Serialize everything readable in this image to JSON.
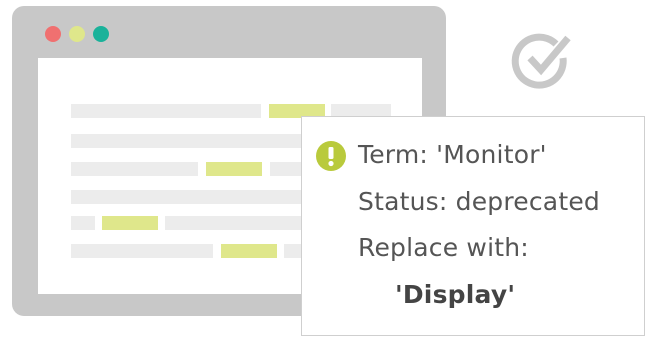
{
  "colors": {
    "frame": "#c8c8c8",
    "dot_red": "#f07070",
    "dot_yellow": "#dfe78b",
    "dot_green": "#1ab29a",
    "highlight": "#dfe78b",
    "placeholder": "#ececec",
    "warning": "#b9ca3c",
    "check": "#c8c8c8"
  },
  "icons": {
    "warning": "exclamation-circle-icon",
    "check": "check-circle-icon"
  },
  "panel": {
    "term": "Term: 'Monitor'",
    "status": "Status: deprecated",
    "replace_label": "Replace with:",
    "replacement": "'Display'"
  }
}
